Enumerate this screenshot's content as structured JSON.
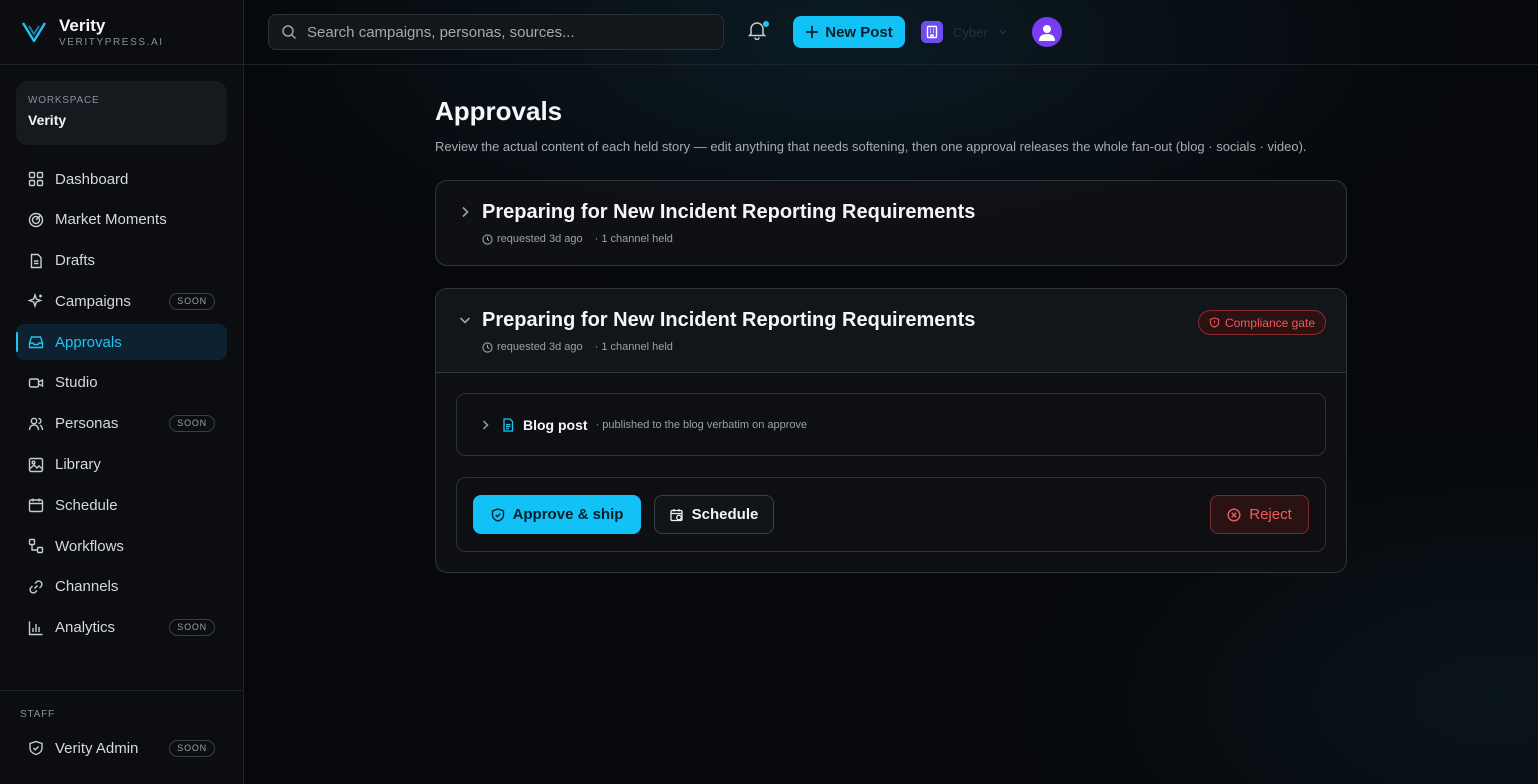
{
  "brand": {
    "name": "Verity",
    "domain": "VERITYPRESS.AI",
    "icon": "verity-logo-icon"
  },
  "workspace": {
    "label": "WORKSPACE",
    "name": "Verity"
  },
  "sidebar": {
    "items": [
      {
        "label": "Dashboard",
        "icon": "grid-icon",
        "badge": ""
      },
      {
        "label": "Market Moments",
        "icon": "radar-icon",
        "badge": ""
      },
      {
        "label": "Drafts",
        "icon": "document-icon",
        "badge": ""
      },
      {
        "label": "Campaigns",
        "icon": "sparkles-icon",
        "badge": "SOON"
      },
      {
        "label": "Approvals",
        "icon": "inbox-icon",
        "badge": "",
        "active": true
      },
      {
        "label": "Studio",
        "icon": "video-icon",
        "badge": ""
      },
      {
        "label": "Personas",
        "icon": "users-icon",
        "badge": "SOON"
      },
      {
        "label": "Library",
        "icon": "image-icon",
        "badge": ""
      },
      {
        "label": "Schedule",
        "icon": "calendar-icon",
        "badge": ""
      },
      {
        "label": "Workflows",
        "icon": "workflow-icon",
        "badge": ""
      },
      {
        "label": "Channels",
        "icon": "link-icon",
        "badge": ""
      },
      {
        "label": "Analytics",
        "icon": "bar-chart-icon",
        "badge": "SOON"
      }
    ],
    "staff_label": "STAFF",
    "staff_items": [
      {
        "label": "Verity Admin",
        "icon": "shield-icon",
        "badge": "SOON"
      }
    ]
  },
  "topbar": {
    "search_placeholder": "Search campaigns, personas, sources...",
    "new_post_label": "New Post",
    "org_name": "Cyber",
    "notification_dot": true
  },
  "page": {
    "title": "Approvals",
    "subtitle": "Review the actual content of each held story — edit anything that needs softening, then one approval releases the whole fan-out (blog · socials · video)."
  },
  "approvals": [
    {
      "title": "Preparing for New Incident Reporting Requirements",
      "requested": "requested 3d ago",
      "channels": "· 1 channel held",
      "expanded": false
    },
    {
      "title": "Preparing for New Incident Reporting Requirements",
      "requested": "requested 3d ago",
      "channels": "· 1 channel held",
      "expanded": true,
      "badge": "Compliance gate",
      "item": {
        "title": "Blog post",
        "note": "· published to the blog verbatim on approve"
      },
      "actions": {
        "approve": "Approve & ship",
        "schedule": "Schedule",
        "reject": "Reject"
      }
    }
  ],
  "colors": {
    "accent": "#12c2f7",
    "danger": "#f05a5c",
    "org": "#6d4cf2",
    "avatar": "#7a3cf0"
  }
}
